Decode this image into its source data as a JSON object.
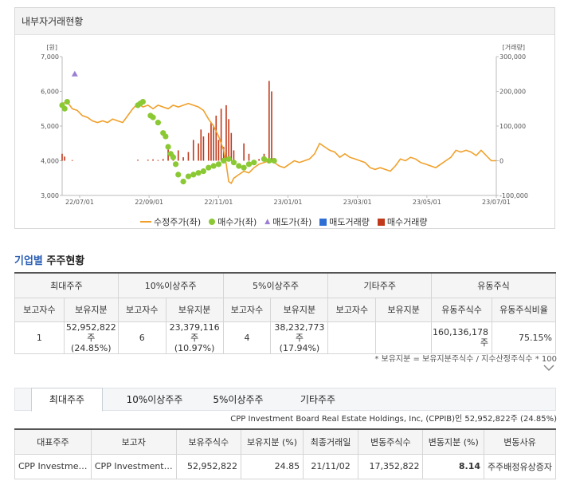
{
  "panel": {
    "title": "내부자거래현황"
  },
  "chart_data": {
    "type": "line",
    "y_left_label": "[원]",
    "y_right_label": "[거래량]",
    "y_left_ticks": [
      "7,000",
      "6,000",
      "5,000",
      "4,000",
      "3,000"
    ],
    "y_right_ticks": [
      "300,000",
      "200,000",
      "100,000",
      "0",
      "-100,000"
    ],
    "x_ticks": [
      "22/07/01",
      "22/09/01",
      "22/11/01",
      "23/01/01",
      "23/03/01",
      "23/05/01",
      "23/07/01"
    ],
    "ylim_left": [
      3000,
      7000
    ],
    "ylim_right": [
      -100000,
      300000
    ],
    "price_series": [
      [
        0,
        5650
      ],
      [
        2,
        5700
      ],
      [
        4,
        5500
      ],
      [
        6,
        5450
      ],
      [
        8,
        5300
      ],
      [
        10,
        5250
      ],
      [
        12,
        5150
      ],
      [
        14,
        5100
      ],
      [
        16,
        5150
      ],
      [
        18,
        5100
      ],
      [
        20,
        5200
      ],
      [
        22,
        5150
      ],
      [
        24,
        5100
      ],
      [
        26,
        5300
      ],
      [
        28,
        5500
      ],
      [
        30,
        5650
      ],
      [
        32,
        5550
      ],
      [
        34,
        5600
      ],
      [
        36,
        5500
      ],
      [
        38,
        5600
      ],
      [
        40,
        5550
      ],
      [
        42,
        5500
      ],
      [
        44,
        5600
      ],
      [
        46,
        5550
      ],
      [
        48,
        5600
      ],
      [
        50,
        5650
      ],
      [
        52,
        5600
      ],
      [
        54,
        5550
      ],
      [
        56,
        5450
      ],
      [
        58,
        5200
      ],
      [
        60,
        5000
      ],
      [
        62,
        4700
      ],
      [
        64,
        4300
      ],
      [
        65,
        3900
      ],
      [
        66,
        3400
      ],
      [
        67,
        3350
      ],
      [
        68,
        3500
      ],
      [
        70,
        3600
      ],
      [
        72,
        3700
      ],
      [
        74,
        3650
      ],
      [
        76,
        3800
      ],
      [
        78,
        3900
      ],
      [
        80,
        3950
      ],
      [
        82,
        4000
      ],
      [
        84,
        3950
      ],
      [
        86,
        3850
      ],
      [
        88,
        3800
      ],
      [
        90,
        3900
      ],
      [
        92,
        4000
      ],
      [
        94,
        3950
      ],
      [
        96,
        4000
      ],
      [
        98,
        4050
      ],
      [
        100,
        4200
      ],
      [
        102,
        4500
      ],
      [
        104,
        4400
      ],
      [
        106,
        4300
      ],
      [
        108,
        4250
      ],
      [
        110,
        4100
      ],
      [
        112,
        4200
      ],
      [
        114,
        4100
      ],
      [
        116,
        4050
      ],
      [
        118,
        4000
      ],
      [
        120,
        3950
      ],
      [
        122,
        3800
      ],
      [
        124,
        3750
      ],
      [
        126,
        3800
      ],
      [
        128,
        3750
      ],
      [
        130,
        3700
      ],
      [
        132,
        3850
      ],
      [
        134,
        4050
      ],
      [
        136,
        4000
      ],
      [
        138,
        4100
      ],
      [
        140,
        4050
      ],
      [
        142,
        3950
      ],
      [
        144,
        3900
      ],
      [
        146,
        3850
      ],
      [
        148,
        3800
      ],
      [
        150,
        3900
      ],
      [
        152,
        4000
      ],
      [
        154,
        4100
      ],
      [
        156,
        4300
      ],
      [
        158,
        4250
      ],
      [
        160,
        4300
      ],
      [
        162,
        4250
      ],
      [
        164,
        4150
      ],
      [
        166,
        4300
      ],
      [
        168,
        4150
      ],
      [
        170,
        4000
      ],
      [
        172,
        4000
      ]
    ],
    "buy_points": [
      [
        0,
        5600
      ],
      [
        1,
        5500
      ],
      [
        2,
        5700
      ],
      [
        30,
        5600
      ],
      [
        31,
        5650
      ],
      [
        32,
        5700
      ],
      [
        35,
        5300
      ],
      [
        36,
        5250
      ],
      [
        38,
        5100
      ],
      [
        40,
        4800
      ],
      [
        41,
        4700
      ],
      [
        42,
        4400
      ],
      [
        43,
        4200
      ],
      [
        44,
        4100
      ],
      [
        45,
        3900
      ],
      [
        46,
        3600
      ],
      [
        48,
        3400
      ],
      [
        50,
        3550
      ],
      [
        52,
        3600
      ],
      [
        54,
        3650
      ],
      [
        56,
        3700
      ],
      [
        58,
        3800
      ],
      [
        60,
        3850
      ],
      [
        62,
        3900
      ],
      [
        64,
        4000
      ],
      [
        66,
        4050
      ],
      [
        68,
        3950
      ],
      [
        70,
        3850
      ],
      [
        72,
        3800
      ],
      [
        74,
        3900
      ],
      [
        76,
        3950
      ],
      [
        80,
        4050
      ],
      [
        82,
        4000
      ],
      [
        84,
        4000
      ]
    ],
    "sell_points": [
      [
        5,
        6500
      ]
    ],
    "buy_volume": [
      [
        0,
        20000
      ],
      [
        1,
        12000
      ],
      [
        4,
        2000
      ],
      [
        30,
        3000
      ],
      [
        34,
        3000
      ],
      [
        36,
        4000
      ],
      [
        38,
        2000
      ],
      [
        40,
        5000
      ],
      [
        42,
        40000
      ],
      [
        44,
        20000
      ],
      [
        46,
        30000
      ],
      [
        48,
        10000
      ],
      [
        50,
        25000
      ],
      [
        52,
        60000
      ],
      [
        54,
        50000
      ],
      [
        55,
        90000
      ],
      [
        56,
        70000
      ],
      [
        58,
        80000
      ],
      [
        59,
        110000
      ],
      [
        60,
        100000
      ],
      [
        61,
        130000
      ],
      [
        62,
        60000
      ],
      [
        63,
        150000
      ],
      [
        64,
        40000
      ],
      [
        65,
        160000
      ],
      [
        66,
        120000
      ],
      [
        67,
        80000
      ],
      [
        68,
        30000
      ],
      [
        72,
        50000
      ],
      [
        74,
        20000
      ],
      [
        78,
        5000
      ],
      [
        80,
        20000
      ],
      [
        82,
        230000
      ],
      [
        83,
        200000
      ],
      [
        84,
        5000
      ]
    ],
    "sell_volume": [],
    "legend": [
      "수정주가(좌)",
      "매수가(좌)",
      "매도가(좌)",
      "매도거래량",
      "매수거래량"
    ],
    "colors": {
      "price": "#f0a02a",
      "buy": "#8ac934",
      "sell": "#9b7fd4",
      "sell_vol": "#2e6fd6",
      "buy_vol": "#c0391b"
    }
  },
  "section": {
    "title_blue": "기업별",
    "title_rest": " 주주현황"
  },
  "summary_table": {
    "groups": [
      "최대주주",
      "10%이상주주",
      "5%이상주주",
      "기타주주",
      "유동주식"
    ],
    "subheaders": [
      "보고자수",
      "보유지분",
      "보고자수",
      "보유지분",
      "보고자수",
      "보유지분",
      "보고자수",
      "보유지분",
      "유동주식수",
      "유동주식비율"
    ],
    "row": {
      "c1": "1",
      "c2a": "52,952,822주",
      "c2b": "(24.85%)",
      "c3": "6",
      "c4a": "23,379,116주",
      "c4b": "(10.97%)",
      "c5": "4",
      "c6a": "38,232,773주",
      "c6b": "(17.94%)",
      "c7": "",
      "c8": "",
      "c9": "160,136,178주",
      "c10": "75.15%"
    }
  },
  "note": "* 보유지분 = 보유지분주식수 / 지수산정주식수 * 100",
  "tabs": [
    "최대주주",
    "10%이상주주",
    "5%이상주주",
    "기타주주"
  ],
  "holder_info": "CPP Investment Board Real Estate Holdings, Inc, (CPPIB)인 52,952,822주 (24.85%)",
  "detail_table": {
    "headers": [
      "대표주주",
      "보고자",
      "보유주식수",
      "보유지분 (%)",
      "최종거래일",
      "변동주식수",
      "변동지분 (%)",
      "변동사유"
    ],
    "row": [
      "CPP Investme…",
      "CPP Investment…",
      "52,952,822",
      "24.85",
      "21/11/02",
      "17,352,822",
      "8.14",
      "주주배정유상증자"
    ]
  }
}
